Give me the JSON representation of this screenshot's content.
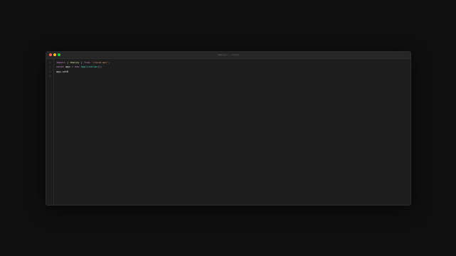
{
  "window": {
    "title": "deploy.js — ~/src/cli"
  },
  "editor": {
    "line_numbers": [
      "1",
      "2",
      "3",
      "4"
    ],
    "lines": [
      [
        {
          "t": "import",
          "c": "kw"
        },
        {
          "t": " { ",
          "c": "pun"
        },
        {
          "t": "deploy",
          "c": "id"
        },
        {
          "t": " } ",
          "c": "pun"
        },
        {
          "t": "from",
          "c": "kw"
        },
        {
          "t": " 'cloud-api'",
          "c": "str"
        },
        {
          "t": ";",
          "c": "pun"
        }
      ],
      [
        {
          "t": "const",
          "c": "kw"
        },
        {
          "t": " app",
          "c": "plain"
        },
        {
          "t": " = ",
          "c": "pun"
        },
        {
          "t": "new",
          "c": "kw"
        },
        {
          "t": " Application",
          "c": "fn"
        },
        {
          "t": "();",
          "c": "pun"
        }
      ],
      [
        {
          "t": "app.setR",
          "c": "plain"
        }
      ],
      []
    ]
  },
  "colors": {
    "close": "#ff5f56",
    "minimize": "#ffbd2e",
    "maximize": "#27c93f",
    "keyword": "#c586c0",
    "string": "#ce9178",
    "class": "#4ec9b0"
  }
}
